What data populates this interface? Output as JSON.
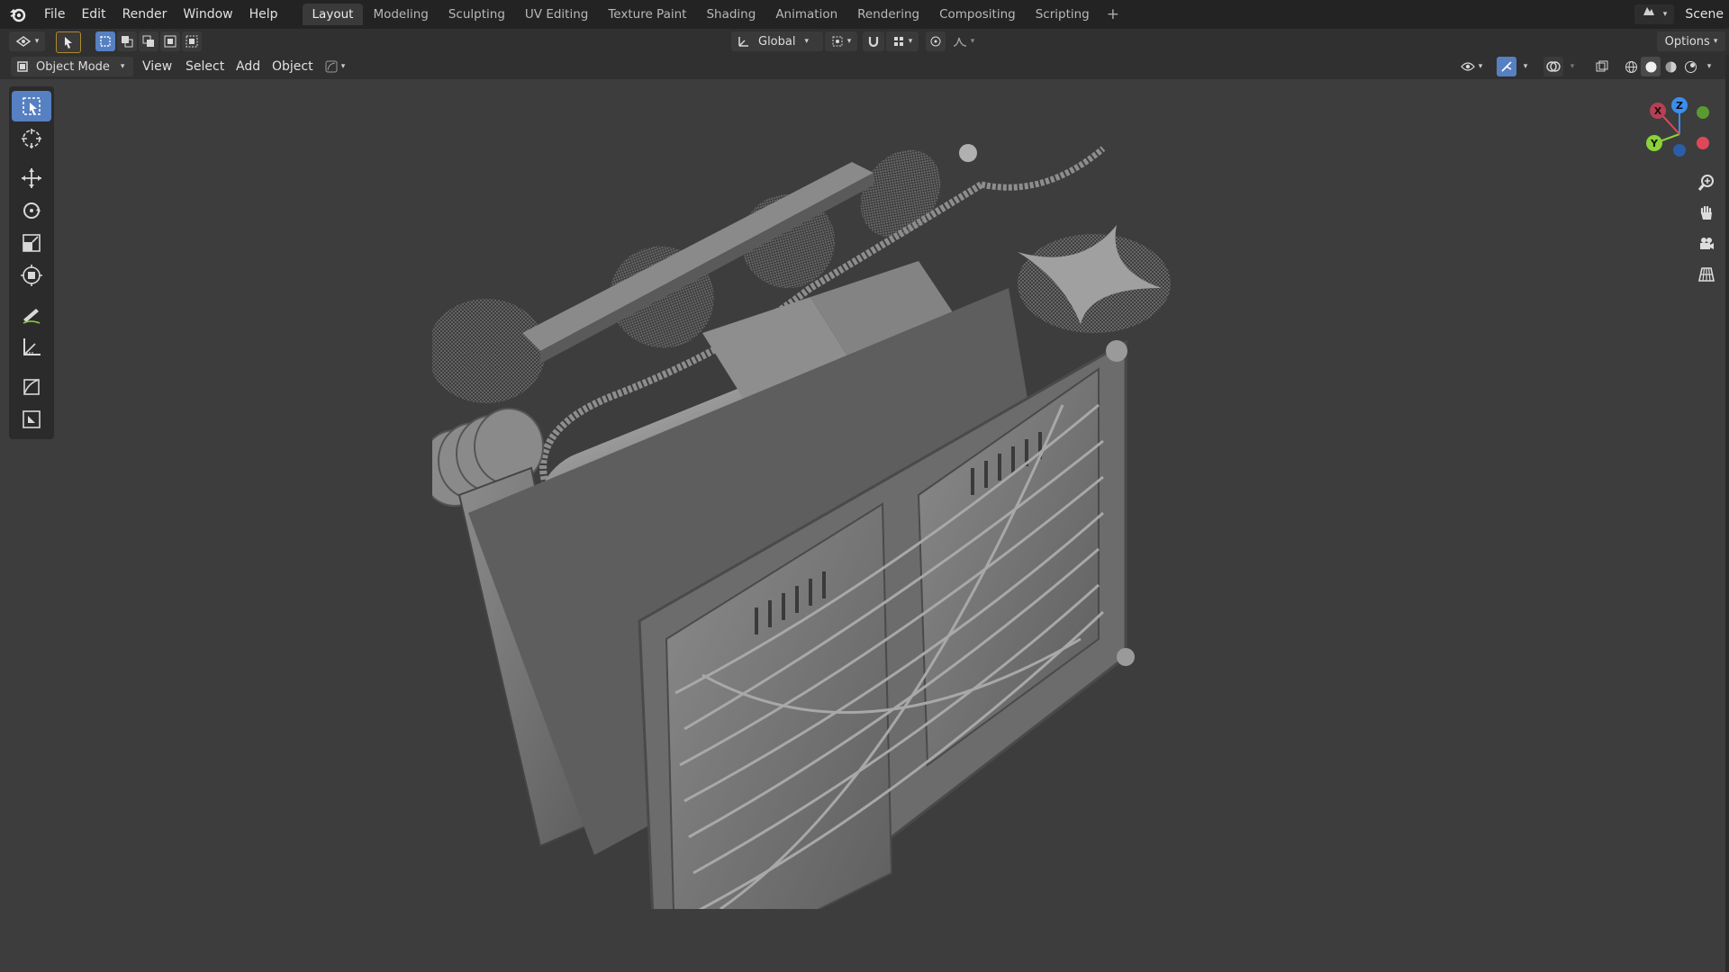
{
  "topbar": {
    "menus": [
      "File",
      "Edit",
      "Render",
      "Window",
      "Help"
    ],
    "workspaces": [
      "Layout",
      "Modeling",
      "Sculpting",
      "UV Editing",
      "Texture Paint",
      "Shading",
      "Animation",
      "Rendering",
      "Compositing",
      "Scripting"
    ],
    "active_workspace": "Layout",
    "add_workspace": "+",
    "scene_label": "Scene"
  },
  "header1": {
    "transform_orientation": "Global",
    "options_label": "Options"
  },
  "header2": {
    "mode": "Object Mode",
    "menus": [
      "View",
      "Select",
      "Add",
      "Object"
    ]
  },
  "gizmo": {
    "x": "X",
    "y": "Y",
    "z": "Z",
    "colors": {
      "x": "#e0485a",
      "y": "#8bd13a",
      "z": "#3a8ef0"
    }
  },
  "tools": [
    "select-box-icon",
    "cursor-icon",
    "move-icon",
    "rotate-icon",
    "scale-icon",
    "transform-icon",
    "annotate-icon",
    "measure-icon",
    "add-cube-icon",
    "add-plane-icon"
  ],
  "colors": {
    "accent": "#5680c2",
    "viewport_bg": "#3d3d3d",
    "header_bg": "#303030",
    "topbar_bg": "#232323"
  }
}
